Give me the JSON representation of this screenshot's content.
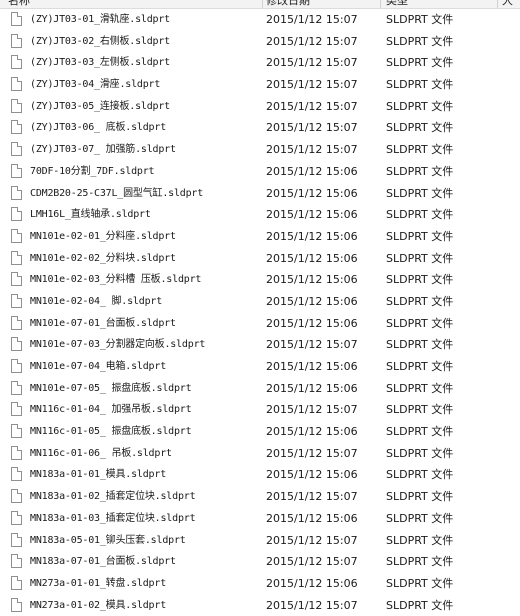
{
  "columns": {
    "name": "名称",
    "date": "修改日期",
    "type": "类型",
    "size": "大"
  },
  "files": [
    {
      "name": "(ZY)JT03-01_滑轨座.sldprt",
      "date": "2015/1/12 15:07",
      "type": "SLDPRT 文件"
    },
    {
      "name": "(ZY)JT03-02_右侧板.sldprt",
      "date": "2015/1/12 15:07",
      "type": "SLDPRT 文件"
    },
    {
      "name": "(ZY)JT03-03_左侧板.sldprt",
      "date": "2015/1/12 15:07",
      "type": "SLDPRT 文件"
    },
    {
      "name": "(ZY)JT03-04_滑座.sldprt",
      "date": "2015/1/12 15:07",
      "type": "SLDPRT 文件"
    },
    {
      "name": "(ZY)JT03-05_连接板.sldprt",
      "date": "2015/1/12 15:07",
      "type": "SLDPRT 文件"
    },
    {
      "name": "(ZY)JT03-06_ 底板.sldprt",
      "date": "2015/1/12 15:07",
      "type": "SLDPRT 文件"
    },
    {
      "name": "(ZY)JT03-07_ 加强筋.sldprt",
      "date": "2015/1/12 15:07",
      "type": "SLDPRT 文件"
    },
    {
      "name": "70DF-10分割_7DF.sldprt",
      "date": "2015/1/12 15:06",
      "type": "SLDPRT 文件"
    },
    {
      "name": "CDM2B20-25-C37L_圆型气缸.sldprt",
      "date": "2015/1/12 15:06",
      "type": "SLDPRT 文件"
    },
    {
      "name": "LMH16L_直线轴承.sldprt",
      "date": "2015/1/12 15:06",
      "type": "SLDPRT 文件"
    },
    {
      "name": "MN101e-02-01_分料座.sldprt",
      "date": "2015/1/12 15:06",
      "type": "SLDPRT 文件"
    },
    {
      "name": "MN101e-02-02_分料块.sldprt",
      "date": "2015/1/12 15:06",
      "type": "SLDPRT 文件"
    },
    {
      "name": "MN101e-02-03_分料槽 压板.sldprt",
      "date": "2015/1/12 15:06",
      "type": "SLDPRT 文件"
    },
    {
      "name": "MN101e-02-04_ 脚.sldprt",
      "date": "2015/1/12 15:06",
      "type": "SLDPRT 文件"
    },
    {
      "name": "MN101e-07-01_台面板.sldprt",
      "date": "2015/1/12 15:06",
      "type": "SLDPRT 文件"
    },
    {
      "name": "MN101e-07-03_分割器定向板.sldprt",
      "date": "2015/1/12 15:07",
      "type": "SLDPRT 文件"
    },
    {
      "name": "MN101e-07-04_电箱.sldprt",
      "date": "2015/1/12 15:06",
      "type": "SLDPRT 文件"
    },
    {
      "name": "MN101e-07-05_ 振盘底板.sldprt",
      "date": "2015/1/12 15:06",
      "type": "SLDPRT 文件"
    },
    {
      "name": "MN116c-01-04_ 加强吊板.sldprt",
      "date": "2015/1/12 15:07",
      "type": "SLDPRT 文件"
    },
    {
      "name": "MN116c-01-05_ 振盘底板.sldprt",
      "date": "2015/1/12 15:06",
      "type": "SLDPRT 文件"
    },
    {
      "name": "MN116c-01-06_ 吊板.sldprt",
      "date": "2015/1/12 15:07",
      "type": "SLDPRT 文件"
    },
    {
      "name": "MN183a-01-01_模具.sldprt",
      "date": "2015/1/12 15:06",
      "type": "SLDPRT 文件"
    },
    {
      "name": "MN183a-01-02_插套定位块.sldprt",
      "date": "2015/1/12 15:07",
      "type": "SLDPRT 文件"
    },
    {
      "name": "MN183a-01-03_插套定位块.sldprt",
      "date": "2015/1/12 15:06",
      "type": "SLDPRT 文件"
    },
    {
      "name": "MN183a-05-01_铆头压套.sldprt",
      "date": "2015/1/12 15:07",
      "type": "SLDPRT 文件"
    },
    {
      "name": "MN183a-07-01_台面板.sldprt",
      "date": "2015/1/12 15:07",
      "type": "SLDPRT 文件"
    },
    {
      "name": "MN273a-01-01_转盘.sldprt",
      "date": "2015/1/12 15:06",
      "type": "SLDPRT 文件"
    },
    {
      "name": "MN273a-01-02_模具.sldprt",
      "date": "2015/1/12 15:07",
      "type": "SLDPRT 文件"
    }
  ]
}
